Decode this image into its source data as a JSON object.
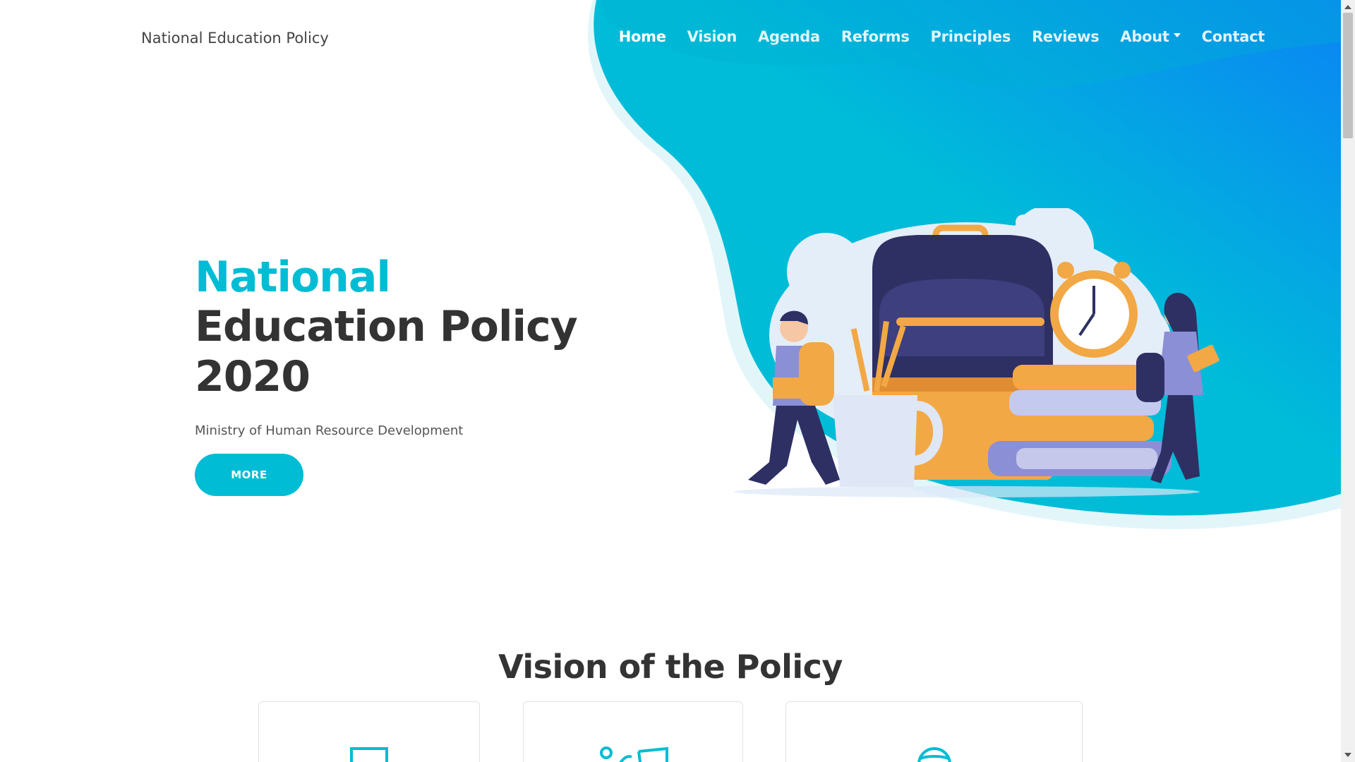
{
  "brand": "National Education Policy",
  "nav": {
    "items": [
      {
        "label": "Home"
      },
      {
        "label": "Vision"
      },
      {
        "label": "Agenda"
      },
      {
        "label": "Reforms"
      },
      {
        "label": "Principles"
      },
      {
        "label": "Reviews"
      },
      {
        "label": "About"
      },
      {
        "label": "Contact"
      }
    ]
  },
  "hero": {
    "title_line1": "National",
    "title_line2": "Education Policy",
    "title_line3": "2020",
    "subtitle": "Ministry of Human Resource Development",
    "button_label": "MORE"
  },
  "vision": {
    "title": "Vision of the Policy"
  },
  "colors": {
    "accent": "#00bcd4",
    "nav_gradient_end": "#0a8ef5",
    "text_dark": "#333333"
  },
  "icons": {
    "hero_illustration": "school-backpack-illustration",
    "card_icons": [
      "book-icon",
      "people-book-icon",
      "globe-icon"
    ]
  }
}
